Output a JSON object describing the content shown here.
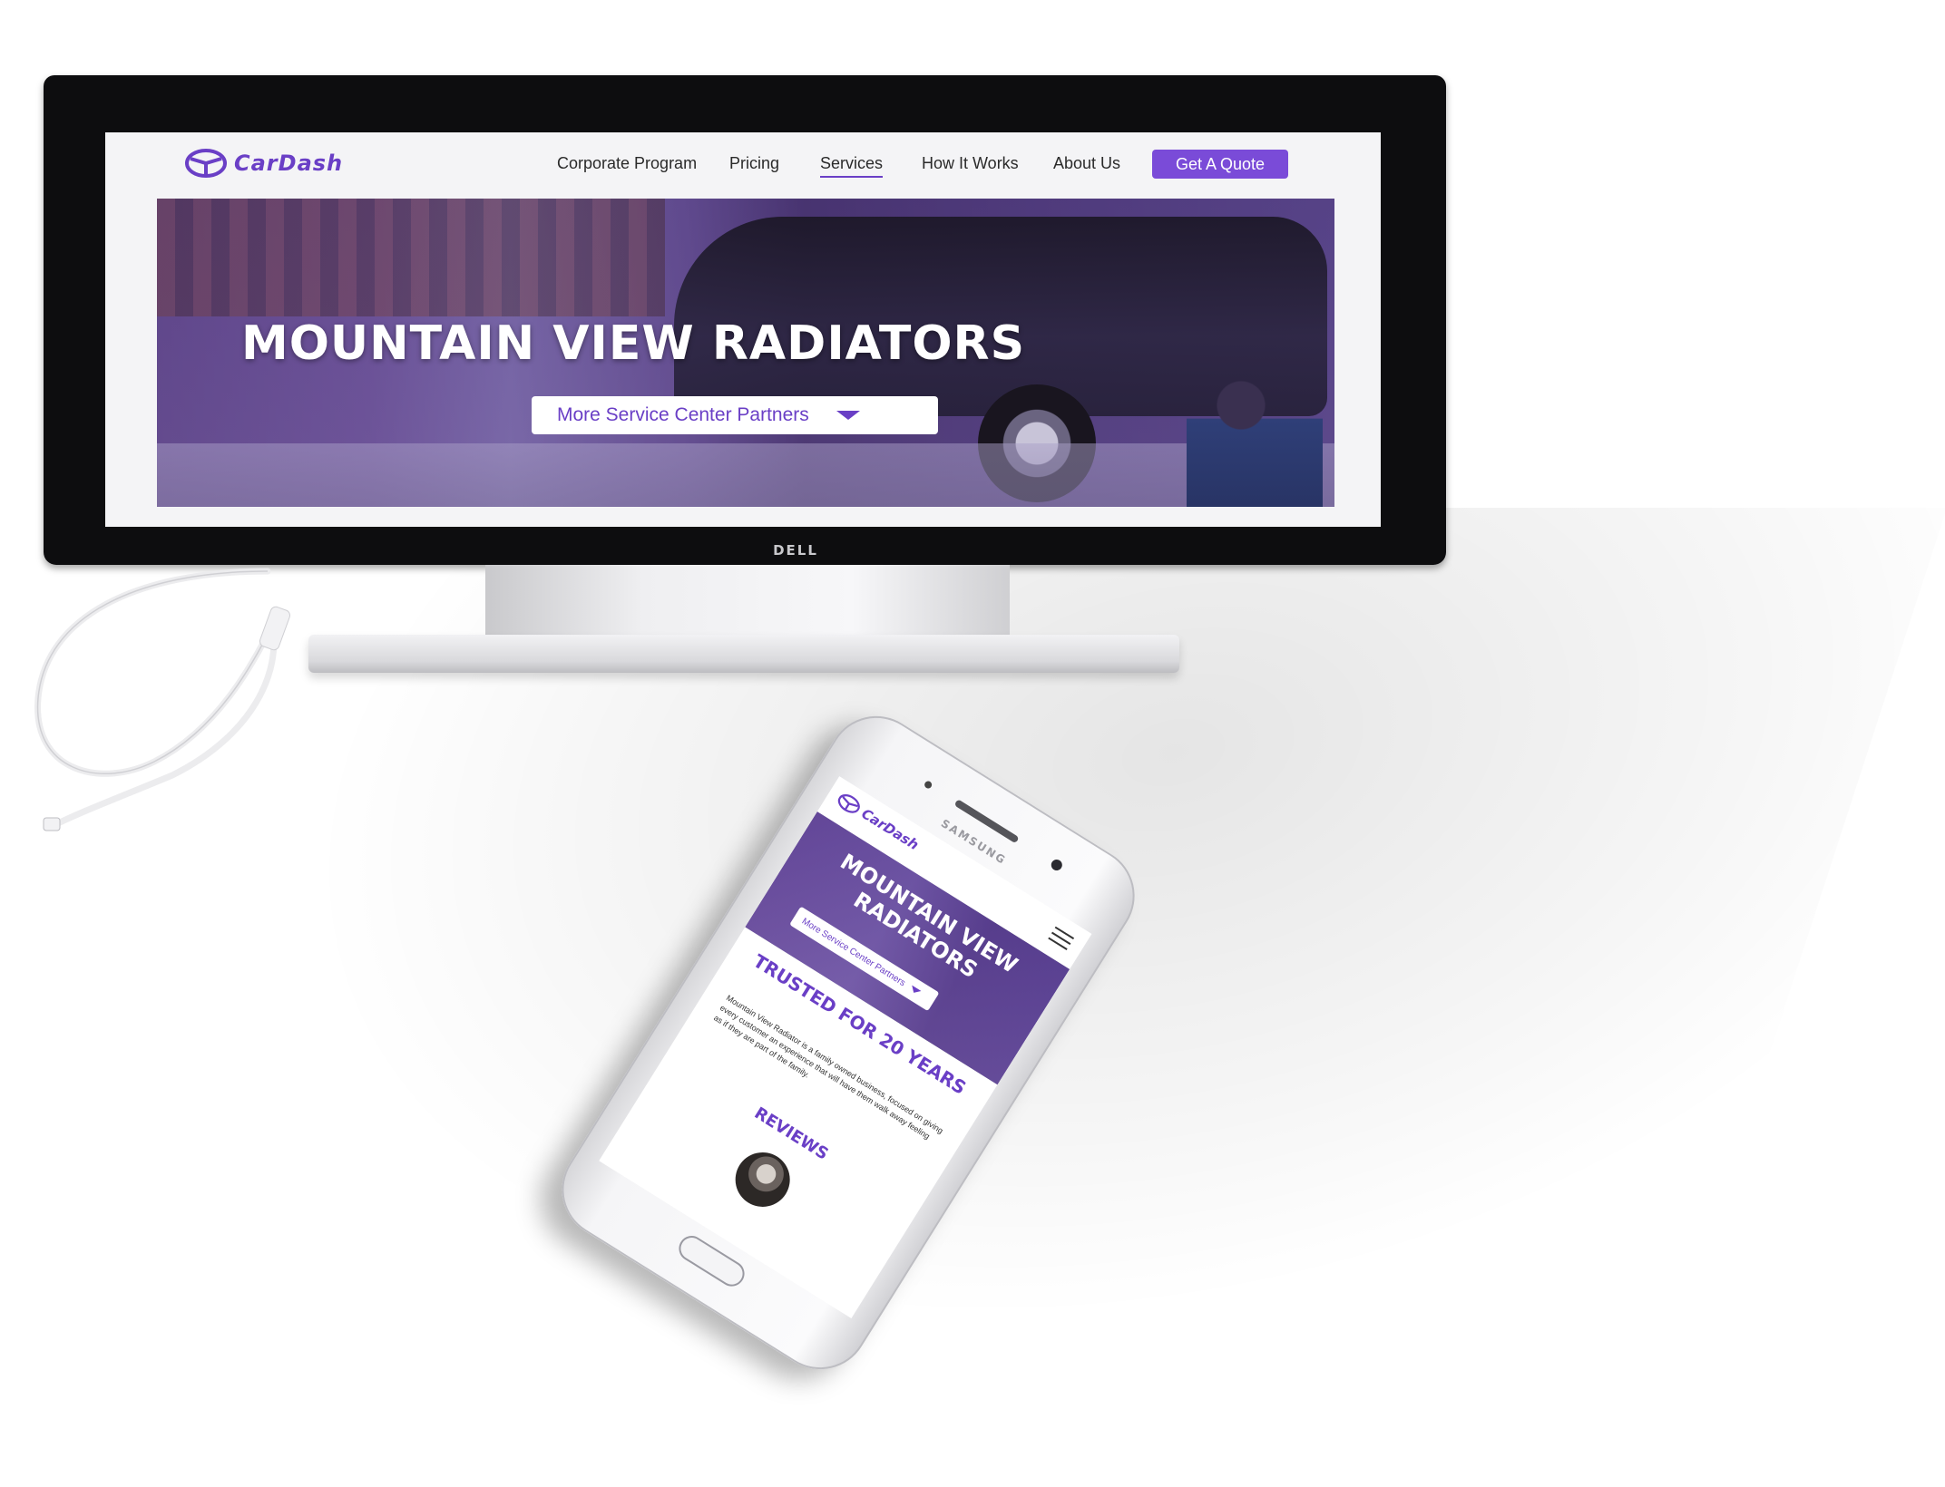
{
  "desktop": {
    "brand": {
      "logo_text": "CarDash",
      "monitor_badge": "DELL"
    },
    "nav": {
      "items": [
        {
          "label": "Corporate Program"
        },
        {
          "label": "Pricing"
        },
        {
          "label": "Services",
          "active": true
        },
        {
          "label": "How It Works"
        },
        {
          "label": "About Us"
        }
      ],
      "cta_label": "Get A Quote"
    },
    "hero": {
      "title": "MOUNTAIN VIEW RADIATORS",
      "dropdown_label": "More Service Center Partners"
    }
  },
  "phone": {
    "brand_badge": "SAMSUNG",
    "logo_text": "CarDash",
    "hero": {
      "title": "MOUNTAIN VIEW RADIATORS",
      "dropdown_label": "More Service Center Partners"
    },
    "trusted_heading": "TRUSTED FOR 20 YEARS",
    "body_text": "Mountain View Radiator is a family owned business, focused on giving every customer an experience that will have them walk away feeling as if they are part of the family.",
    "reviews_heading": "REVIEWS"
  },
  "colors": {
    "accent": "#6a3fc6",
    "cta": "#7a4bd8",
    "hero_overlay": "#6040a0"
  },
  "icons": [
    "cardash-logo-icon",
    "caret-down-icon",
    "hamburger-icon"
  ]
}
